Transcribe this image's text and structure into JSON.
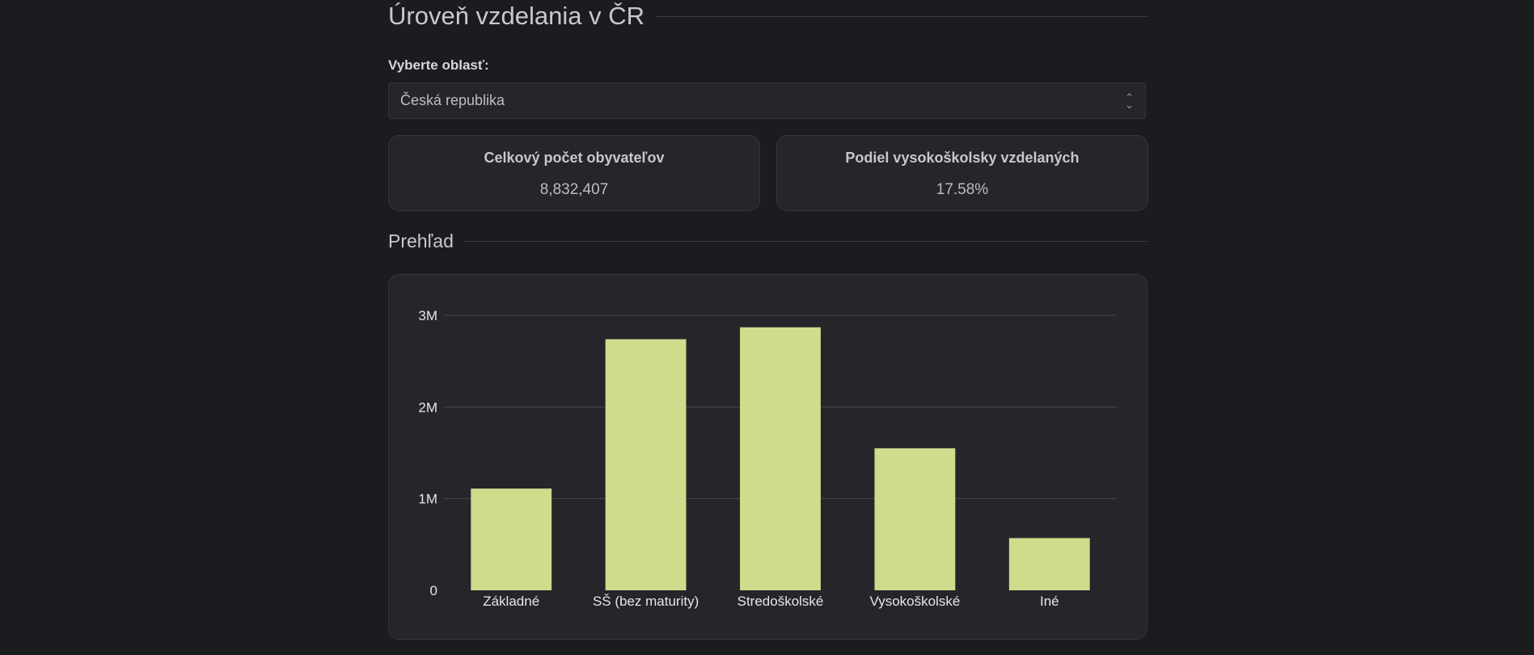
{
  "page": {
    "title": "Úroveň vzdelania v ČR",
    "region_label": "Vyberte oblasť:",
    "region_selected": "Česká republika",
    "overview_title": "Prehľad"
  },
  "stats": {
    "population": {
      "label": "Celkový počet obyvateľov",
      "value": "8,832,407"
    },
    "university_share": {
      "label": "Podiel vysokoškolsky vzdelaných",
      "value": "17.58%"
    }
  },
  "icons": {
    "select_chevron": "chevron-up-down-icon"
  },
  "colors": {
    "bar": "#d0dc8b",
    "gridline": "#46474d"
  },
  "chart_data": {
    "type": "bar",
    "categories": [
      "Základné",
      "SŠ (bez maturity)",
      "Stredoškolské",
      "Vysokoškolské",
      "Iné"
    ],
    "values": [
      1110000,
      2740000,
      2870000,
      1550000,
      570000
    ],
    "ylim": [
      0,
      3000000
    ],
    "yticks": [
      0,
      1000000,
      2000000,
      3000000
    ],
    "ytick_labels": [
      "0",
      "1M",
      "2M",
      "3M"
    ],
    "grid": true,
    "legend": "none"
  }
}
